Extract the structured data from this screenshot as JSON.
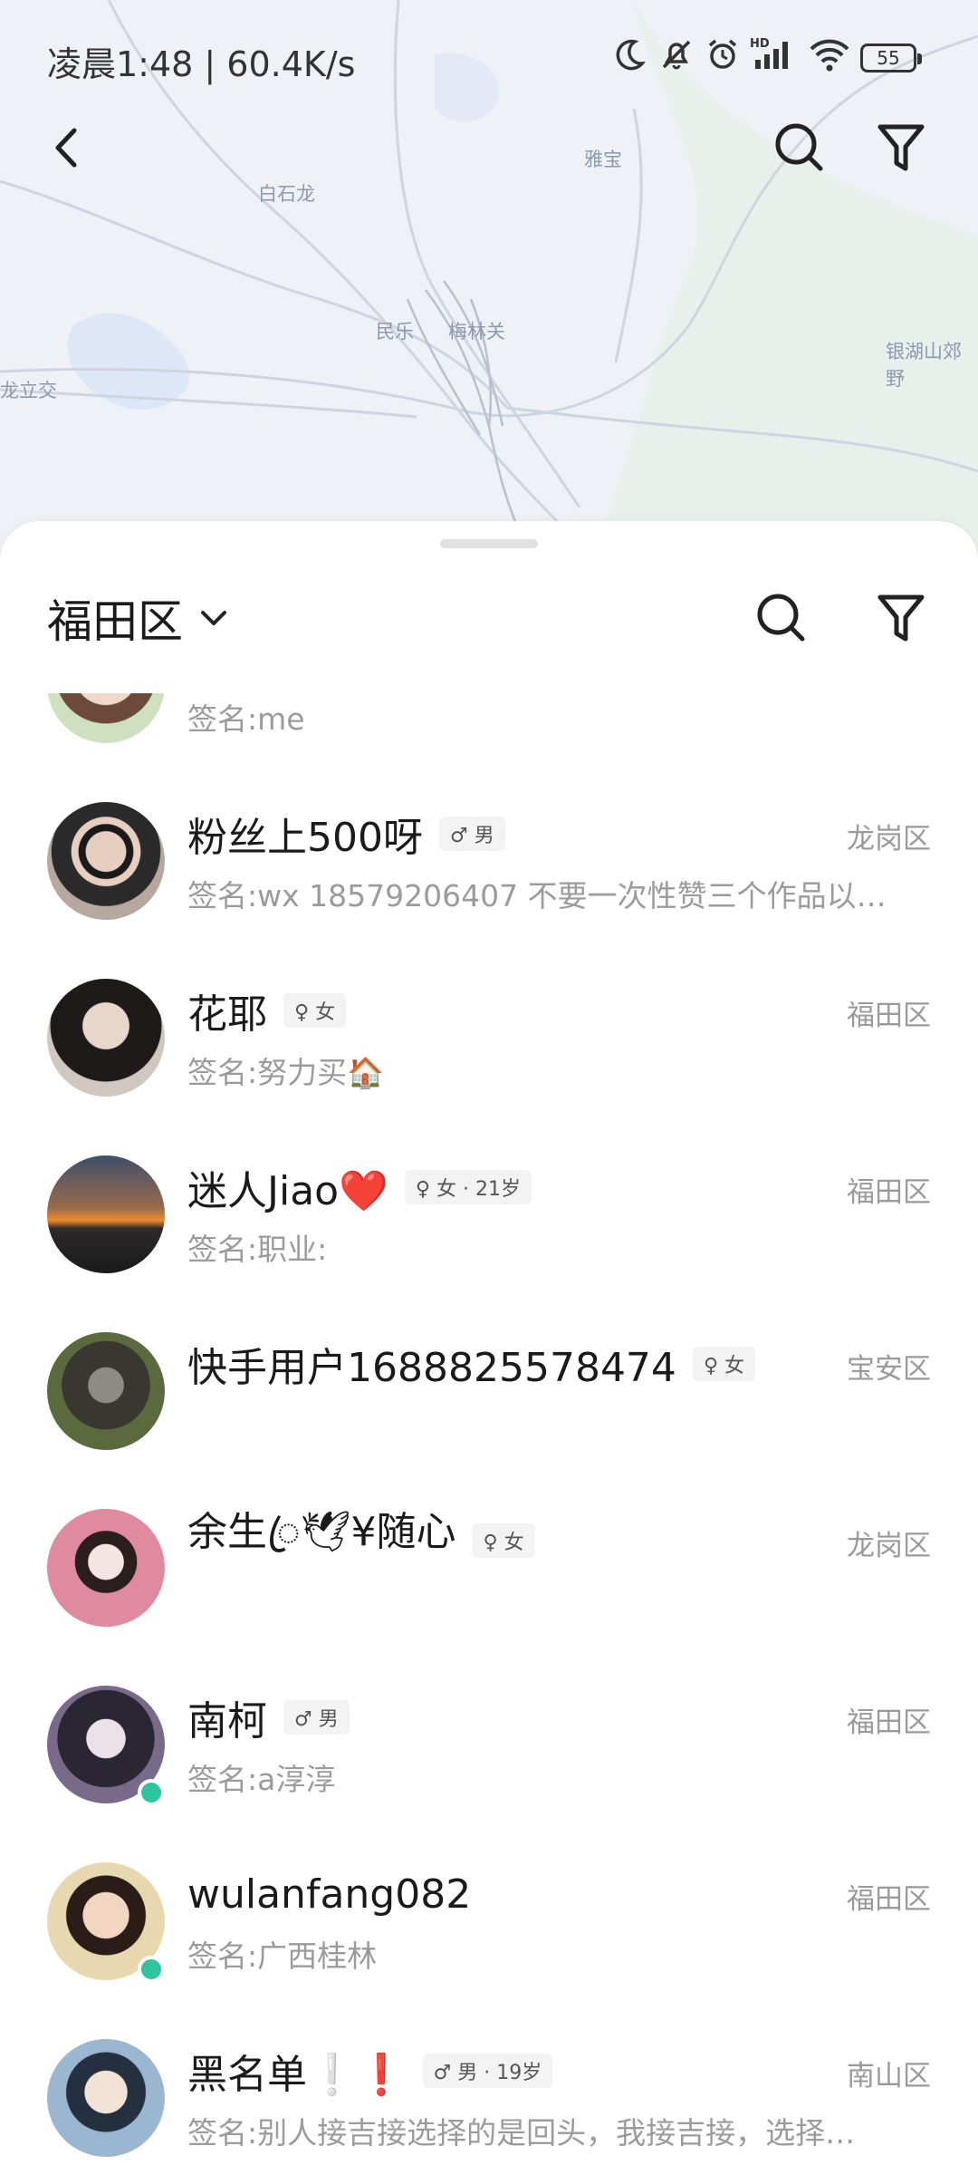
{
  "status_bar": {
    "time": "凌晨1:48 | 60.4K/s",
    "icons": [
      "moon-icon",
      "mute-bell-icon",
      "alarm-icon",
      "hd-signal-icon",
      "wifi-icon",
      "battery-icon"
    ],
    "battery": "55"
  },
  "map": {
    "labels": [
      "白石龙",
      "雅宝",
      "民乐",
      "梅林关",
      "银湖山郊野",
      "龙立交"
    ]
  },
  "top_bar": {
    "icons": [
      "back-arrow-icon",
      "search-icon",
      "filter-icon"
    ]
  },
  "sheet": {
    "district": "福田区",
    "icons": [
      "chevron-down-icon",
      "search-icon",
      "filter-icon"
    ]
  },
  "colors": {
    "online": "#2fc3a0",
    "badge_bg": "#f3f3f3",
    "secondary_text": "#9b9b9b"
  },
  "users": [
    {
      "name": "",
      "badge": "",
      "district": "",
      "signature": "签名:me",
      "online": false
    },
    {
      "name": "粉丝上500呀",
      "badge": "♂ 男",
      "district": "龙岗区",
      "signature": "签名:wx  18579206407 不要一次性赞三个作品以…",
      "online": false
    },
    {
      "name": "花耶",
      "badge": "♀ 女",
      "district": "福田区",
      "signature": "签名:努力买🏠",
      "online": false
    },
    {
      "name": "迷人Jiao❤️",
      "badge": "♀ 女 · 21岁",
      "district": "福田区",
      "signature": "签名:职业:",
      "online": false
    },
    {
      "name": "快手用户1688825578474",
      "badge": "♀ 女",
      "district": "宝安区",
      "signature": "",
      "online": false
    },
    {
      "name": "余生ꦿ🕊¥随心",
      "badge": "♀ 女",
      "district": "龙岗区",
      "signature": "",
      "online": false
    },
    {
      "name": "南柯",
      "badge": "♂ 男",
      "district": "福田区",
      "signature": "签名:a淳淳",
      "online": true
    },
    {
      "name": "wulanfang082",
      "badge": "",
      "district": "福田区",
      "signature": "签名:广西桂林",
      "online": true
    },
    {
      "name": "黑名单❕❗",
      "badge": "♂ 男 · 19岁",
      "district": "南山区",
      "signature": "签名:别人接吉接选择的是回头，我接吉接，选择…",
      "online": false
    }
  ]
}
